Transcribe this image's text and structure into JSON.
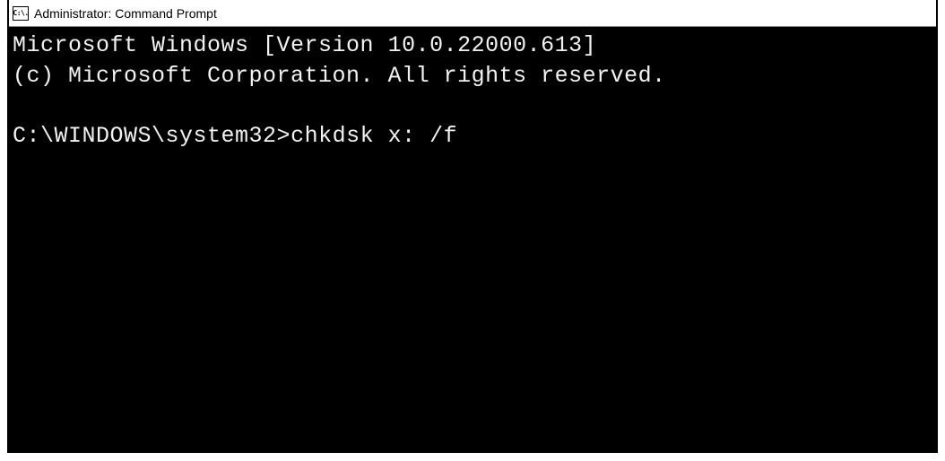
{
  "titlebar": {
    "icon_text": "C:\\.",
    "title": "Administrator: Command Prompt"
  },
  "terminal": {
    "line1": "Microsoft Windows [Version 10.0.22000.613]",
    "line2": "(c) Microsoft Corporation. All rights reserved.",
    "blank": "",
    "prompt": "C:\\WINDOWS\\system32>",
    "command": "chkdsk x: /f"
  }
}
